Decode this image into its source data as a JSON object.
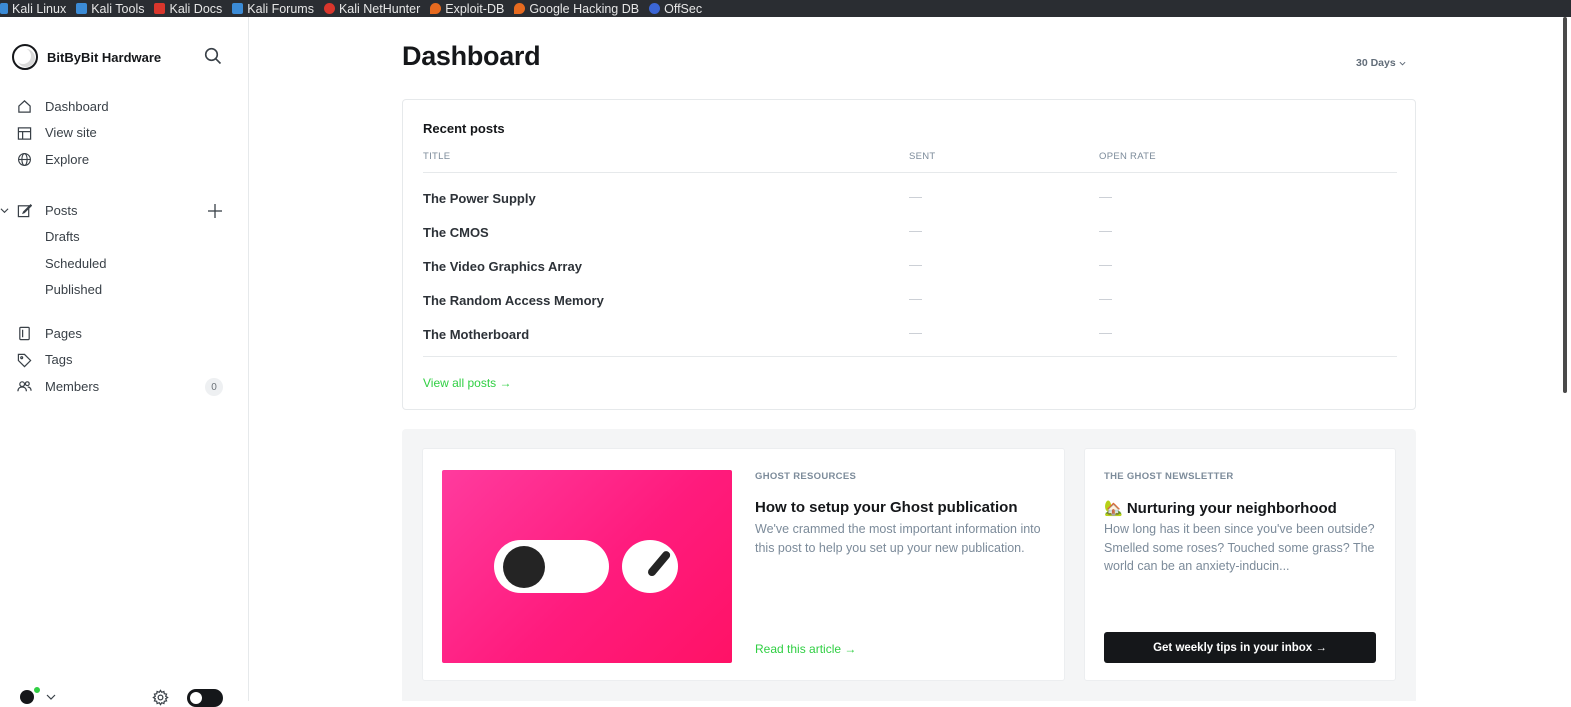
{
  "bookmarks": [
    {
      "label": "Kali Linux",
      "icon": "kali-icon",
      "color": "#3b8bd6"
    },
    {
      "label": "Kali Tools",
      "icon": "kali-tools-icon",
      "color": "#3b8bd6"
    },
    {
      "label": "Kali Docs",
      "icon": "kali-docs-icon",
      "color": "#d9362c"
    },
    {
      "label": "Kali Forums",
      "icon": "kali-forums-icon",
      "color": "#3b8bd6"
    },
    {
      "label": "Kali NetHunter",
      "icon": "nethunter-icon",
      "color": "#d9362c"
    },
    {
      "label": "Exploit-DB",
      "icon": "exploit-db-icon",
      "color": "#e66a1f"
    },
    {
      "label": "Google Hacking DB",
      "icon": "ghdb-icon",
      "color": "#e66a1f"
    },
    {
      "label": "OffSec",
      "icon": "offsec-icon",
      "color": "#3b66d6"
    }
  ],
  "sidebar": {
    "brand": "BitByBit Hardware",
    "primary": [
      {
        "label": "Dashboard",
        "icon": "home-icon"
      },
      {
        "label": "View site",
        "icon": "layout-icon"
      },
      {
        "label": "Explore",
        "icon": "globe-icon"
      }
    ],
    "posts": {
      "label": "Posts",
      "icon": "edit-icon",
      "sub": [
        "Drafts",
        "Scheduled",
        "Published"
      ]
    },
    "secondary": [
      {
        "label": "Pages",
        "icon": "pages-icon"
      },
      {
        "label": "Tags",
        "icon": "tag-icon"
      },
      {
        "label": "Members",
        "icon": "members-icon",
        "count": "0"
      }
    ]
  },
  "main": {
    "title": "Dashboard",
    "range": "30 Days",
    "recent_posts": {
      "title": "Recent posts",
      "columns": [
        "TITLE",
        "SENT",
        "OPEN RATE"
      ],
      "rows": [
        {
          "title": "The Power Supply",
          "sent": "—",
          "open_rate": "—"
        },
        {
          "title": "The CMOS",
          "sent": "—",
          "open_rate": "—"
        },
        {
          "title": "The Video Graphics Array",
          "sent": "—",
          "open_rate": "—"
        },
        {
          "title": "The Random Access Memory",
          "sent": "—",
          "open_rate": "—"
        },
        {
          "title": "The Motherboard",
          "sent": "—",
          "open_rate": "—"
        }
      ],
      "view_all": "View all posts →"
    },
    "resources": {
      "kicker": "GHOST RESOURCES",
      "headline": "How to setup your Ghost publication",
      "excerpt": "We've crammed the most important information into this post to help you set up your new publication.",
      "link": "Read this article →"
    },
    "newsletter": {
      "kicker": "THE GHOST NEWSLETTER",
      "headline": "🏡 Nurturing your neighborhood",
      "excerpt": "How long has it been since you've been outside? Smelled some roses? Touched some grass? The world can be an anxiety-inducin...",
      "button": "Get weekly tips in your inbox →"
    }
  },
  "colors": {
    "accent_green": "#30cf43",
    "pink": "#ff1b7d",
    "dark": "#15171a"
  }
}
